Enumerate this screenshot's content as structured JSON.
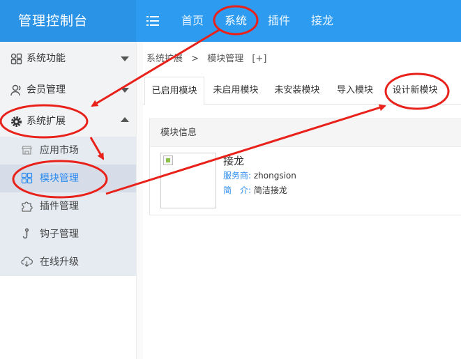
{
  "header": {
    "brand": "管理控制台",
    "menu_icon": "hamburger-menu-icon",
    "nav": [
      "首页",
      "系统",
      "插件",
      "接龙"
    ]
  },
  "sidebar": {
    "groups": [
      {
        "label": "系统功能",
        "icon": "grid-icon",
        "expanded": false
      },
      {
        "label": "会员管理",
        "icon": "user-icon",
        "expanded": false
      },
      {
        "label": "系统扩展",
        "icon": "gear-icon",
        "expanded": true
      }
    ],
    "sub_items": [
      {
        "label": "应用市场",
        "icon": "store-icon"
      },
      {
        "label": "模块管理",
        "icon": "modules-icon",
        "active": true
      },
      {
        "label": "插件管理",
        "icon": "puzzle-icon"
      },
      {
        "label": "钩子管理",
        "icon": "hook-icon"
      },
      {
        "label": "在线升级",
        "icon": "cloud-download-icon"
      }
    ]
  },
  "breadcrumb": {
    "part1": "系统扩展",
    "sep": ">",
    "part2": "模块管理",
    "extra": "[+]"
  },
  "tabs": [
    "已启用模块",
    "未启用模块",
    "未安装模块",
    "导入模块",
    "设计新模块"
  ],
  "panel": {
    "title": "模块信息",
    "module": {
      "name": "接龙",
      "provider_key": "服务商:",
      "provider": "zhongsion",
      "intro_key": "简　介:",
      "intro": "简洁接龙"
    }
  },
  "colors": {
    "topbar": "#2d9cf0",
    "active_link": "#2d8cf0",
    "annotation": "#e8211a"
  }
}
